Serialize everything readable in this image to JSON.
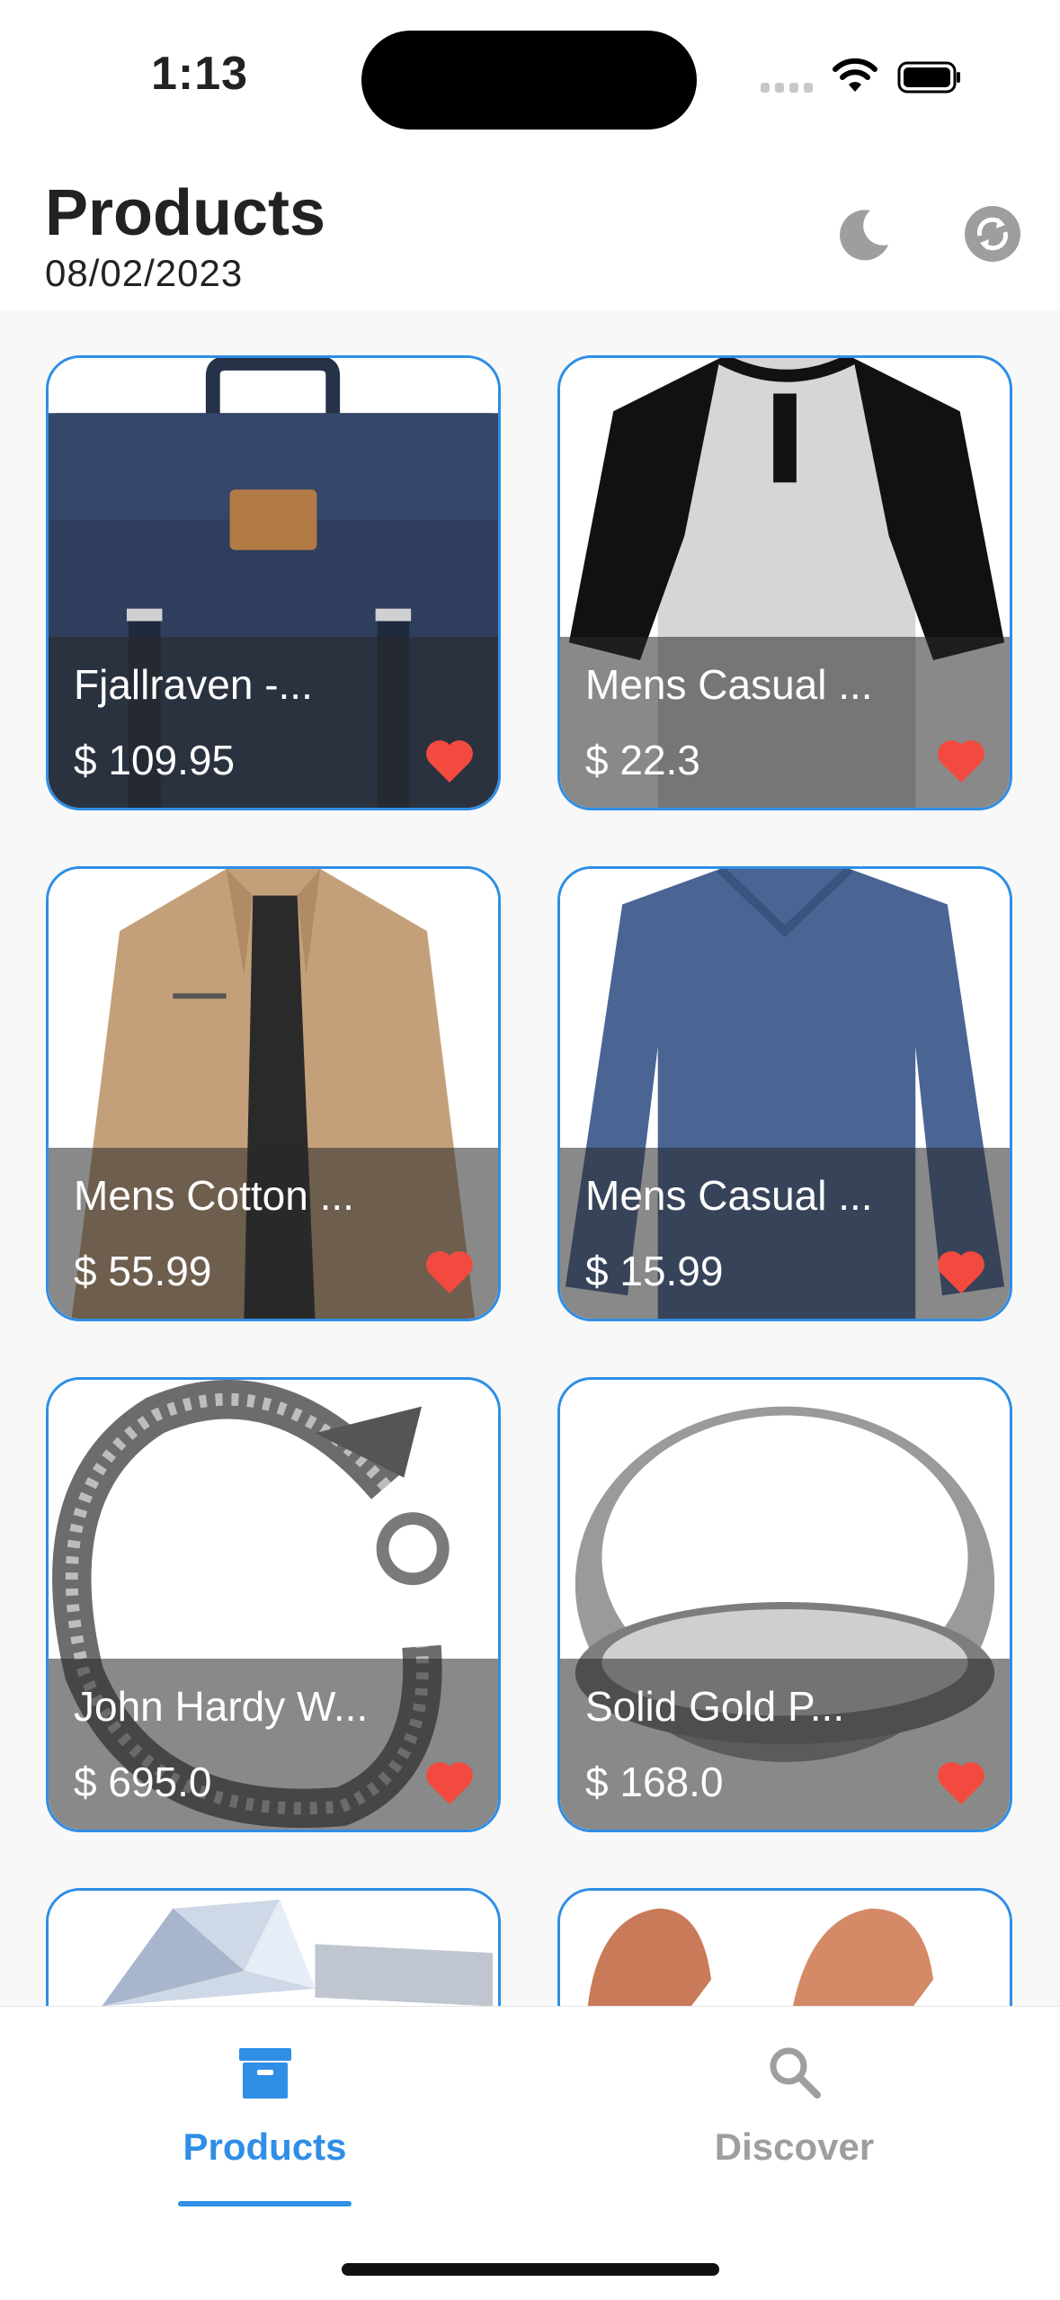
{
  "status_bar": {
    "time": "1:13"
  },
  "header": {
    "title": "Products",
    "date": "08/02/2023"
  },
  "colors": {
    "accent": "#2f8ee6",
    "favorite": "#f24a3e",
    "inactive": "#9e9e9e"
  },
  "icons": {
    "theme_toggle": "moon-icon",
    "refresh": "sync-icon",
    "favorite": "heart-icon"
  },
  "products": [
    {
      "name": "Fjallraven -...",
      "price": "$ 109.95"
    },
    {
      "name": "Mens Casual ...",
      "price": "$ 22.3"
    },
    {
      "name": "Mens Cotton ...",
      "price": "$ 55.99"
    },
    {
      "name": "Mens Casual ...",
      "price": "$ 15.99"
    },
    {
      "name": "John Hardy W...",
      "price": "$ 695.0"
    },
    {
      "name": "Solid Gold P...",
      "price": "$ 168.0"
    }
  ],
  "bottom_nav": {
    "items": [
      {
        "label": "Products",
        "icon": "archive-box-icon",
        "active": true
      },
      {
        "label": "Discover",
        "icon": "search-icon",
        "active": false
      }
    ]
  }
}
